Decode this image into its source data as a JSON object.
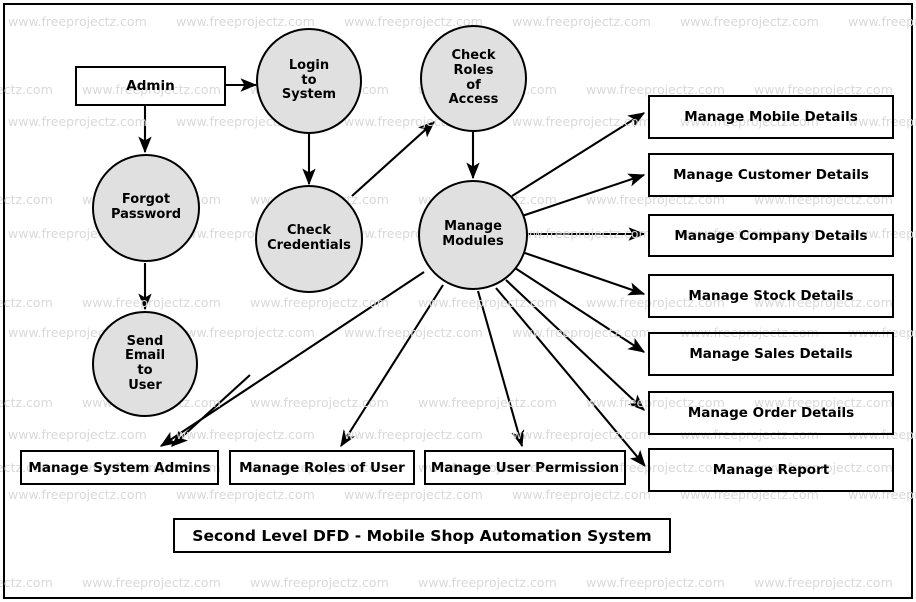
{
  "diagram": {
    "title": "Second Level DFD - Mobile Shop Automation System",
    "watermark_text": "www.freeprojectz.com",
    "colors": {
      "process_fill": "#e0e0e0",
      "stroke": "#000000",
      "background": "#ffffff",
      "watermark": "#d9d9d9"
    }
  },
  "entities": {
    "admin": "Admin"
  },
  "processes": [
    {
      "id": "login_to_system",
      "label": "Login\nto\nSystem",
      "lines": [
        "Login",
        "to",
        "System"
      ]
    },
    {
      "id": "check_roles_of_access",
      "label": "Check\nRoles\nof\nAccess",
      "lines": [
        "Check",
        "Roles",
        "of",
        "Access"
      ]
    },
    {
      "id": "forgot_password",
      "label": "Forgot\nPassword",
      "lines": [
        "Forgot",
        "Password"
      ]
    },
    {
      "id": "check_credentials",
      "label": "Check\nCredentials",
      "lines": [
        "Check",
        "Credentials"
      ]
    },
    {
      "id": "send_email_to_user",
      "label": "Send\nEmail\nto\nUser",
      "lines": [
        "Send",
        "Email",
        "to",
        "User"
      ]
    },
    {
      "id": "manage_modules",
      "label": "Manage\nModules",
      "lines": [
        "Manage",
        "Modules"
      ]
    }
  ],
  "right_stores": [
    {
      "id": "manage_mobile_details",
      "label": "Manage Mobile Details"
    },
    {
      "id": "manage_customer_details",
      "label": "Manage Customer Details"
    },
    {
      "id": "manage_company_details",
      "label": "Manage Company Details"
    },
    {
      "id": "manage_stock_details",
      "label": "Manage Stock Details"
    },
    {
      "id": "manage_sales_details",
      "label": "Manage Sales Details"
    },
    {
      "id": "manage_order_details",
      "label": "Manage Order Details"
    },
    {
      "id": "manage_report",
      "label": "Manage Report"
    }
  ],
  "bottom_stores": [
    {
      "id": "manage_system_admins",
      "label": "Manage System Admins"
    },
    {
      "id": "manage_roles_of_user",
      "label": "Manage Roles of User"
    },
    {
      "id": "manage_user_permission",
      "label": "Manage User Permission"
    }
  ],
  "flows": [
    {
      "from": "admin",
      "to": "login_to_system"
    },
    {
      "from": "admin",
      "to": "forgot_password"
    },
    {
      "from": "login_to_system",
      "to": "check_credentials"
    },
    {
      "from": "check_credentials",
      "to": "check_roles_of_access"
    },
    {
      "from": "check_roles_of_access",
      "to": "manage_modules"
    },
    {
      "from": "forgot_password",
      "to": "send_email_to_user"
    },
    {
      "from": "send_email_to_user",
      "to": "manage_system_admins"
    },
    {
      "from": "manage_modules",
      "to": "manage_mobile_details"
    },
    {
      "from": "manage_modules",
      "to": "manage_customer_details"
    },
    {
      "from": "manage_modules",
      "to": "manage_company_details"
    },
    {
      "from": "manage_modules",
      "to": "manage_stock_details"
    },
    {
      "from": "manage_modules",
      "to": "manage_sales_details"
    },
    {
      "from": "manage_modules",
      "to": "manage_order_details"
    },
    {
      "from": "manage_modules",
      "to": "manage_report"
    },
    {
      "from": "manage_modules",
      "to": "manage_system_admins"
    },
    {
      "from": "manage_modules",
      "to": "manage_roles_of_user"
    },
    {
      "from": "manage_modules",
      "to": "manage_user_permission"
    }
  ]
}
